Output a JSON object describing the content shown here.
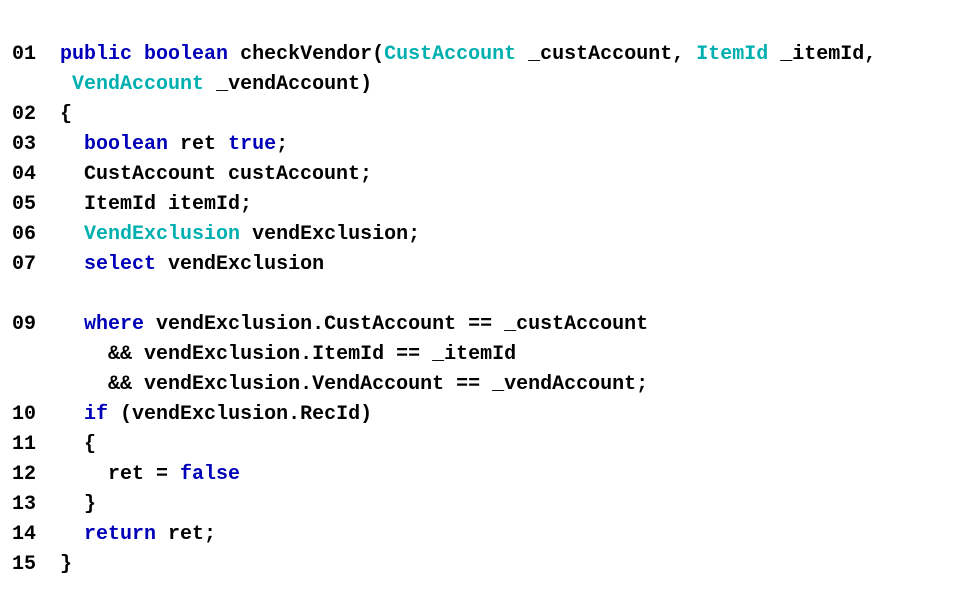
{
  "code": {
    "ln": {
      "l01": "01",
      "l02": "02",
      "l03": "03",
      "l04": "04",
      "l05": "05",
      "l06": "06",
      "l07": "07",
      "l09": "09",
      "l10": "10",
      "l11": "11",
      "l12": "12",
      "l13": "13",
      "l14": "14",
      "l15": "15"
    },
    "t": {
      "public": "public",
      "boolean": "boolean",
      "checkVendor": "checkVendor",
      "lparen": "(",
      "rparen": ")",
      "comma": ",",
      "space": " ",
      "CustAccount": "CustAccount",
      "p_custAccount": "_custAccount",
      "ItemId": "ItemId",
      "p_itemId": "_itemId",
      "VendAccount": "VendAccount",
      "p_vendAccount": "_vendAccount",
      "lbrace": "{",
      "rbrace": "}",
      "ret": "ret",
      "true": "true",
      "semi": ";",
      "custAccount_decl": "CustAccount custAccount;",
      "itemId_decl": "ItemId itemId;",
      "VendExclusion": "VendExclusion",
      "vendExclusion": "vendExclusion",
      "vendExclusion_semi": "vendExclusion;",
      "select": "select",
      "where": "where",
      "expr_cust": "vendExclusion.CustAccount == _custAccount",
      "and": "&&",
      "expr_item": "vendExclusion.ItemId == _itemId",
      "expr_vend": "vendExclusion.VendAccount == _vendAccount;",
      "if": "if",
      "cond": "(vendExclusion.RecId)",
      "assign": "ret = ",
      "false": "false",
      "return": "return",
      "ret_semi": "ret;"
    }
  },
  "chart_data": null
}
